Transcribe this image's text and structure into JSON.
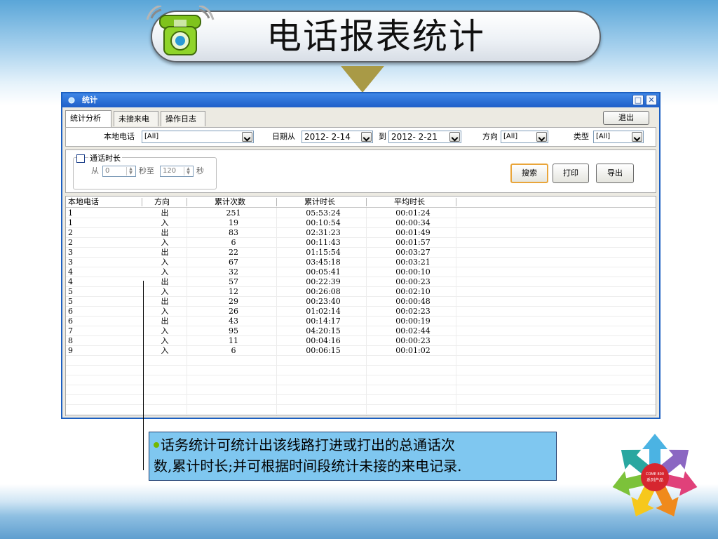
{
  "slide": {
    "title": "电话报表统计",
    "note_lines": [
      "话务统计可统计出该线路打进或打出的总通话次",
      "数,累计时长;并可根据时间段统计未接的来电记录."
    ],
    "logo_text_1": "COME 800",
    "logo_text_2": "系列产品"
  },
  "window": {
    "title": "统计",
    "tabs": [
      "统计分析",
      "未接来电",
      "操作日志"
    ],
    "exit_label": "退出",
    "filters": {
      "local_phone_label": "本地电话",
      "local_phone_value": "[All]",
      "date_from_label": "日期从",
      "date_from_value": "2012-  2-14",
      "date_to_label": "到",
      "date_to_value": "2012-  2-21",
      "direction_label": "方向",
      "direction_value": "[All]",
      "type_label": "类型",
      "type_value": "[All]"
    },
    "duration": {
      "group_label": "通话时长",
      "from_label": "从",
      "from_value": "0",
      "mid_label": "秒至",
      "to_value": "120",
      "unit_label": "秒"
    },
    "buttons": {
      "search": "搜索",
      "print": "打印",
      "export": "导出"
    },
    "table": {
      "headers": [
        "本地电话",
        "方向",
        "累计次数",
        "累计时长",
        "平均时长"
      ],
      "rows": [
        [
          "1",
          "出",
          "251",
          "05:53:24",
          "00:01:24"
        ],
        [
          "1",
          "入",
          "19",
          "00:10:54",
          "00:00:34"
        ],
        [
          "2",
          "出",
          "83",
          "02:31:23",
          "00:01:49"
        ],
        [
          "2",
          "入",
          "6",
          "00:11:43",
          "00:01:57"
        ],
        [
          "3",
          "出",
          "22",
          "01:15:54",
          "00:03:27"
        ],
        [
          "3",
          "入",
          "67",
          "03:45:18",
          "00:03:21"
        ],
        [
          "4",
          "入",
          "32",
          "00:05:41",
          "00:00:10"
        ],
        [
          "4",
          "出",
          "57",
          "00:22:39",
          "00:00:23"
        ],
        [
          "5",
          "入",
          "12",
          "00:26:08",
          "00:02:10"
        ],
        [
          "5",
          "出",
          "29",
          "00:23:40",
          "00:00:48"
        ],
        [
          "6",
          "入",
          "26",
          "01:02:14",
          "00:02:23"
        ],
        [
          "6",
          "出",
          "43",
          "00:14:17",
          "00:00:19"
        ],
        [
          "7",
          "入",
          "95",
          "04:20:15",
          "00:02:44"
        ],
        [
          "8",
          "入",
          "11",
          "00:04:16",
          "00:00:23"
        ],
        [
          "9",
          "入",
          "6",
          "00:06:15",
          "00:01:02"
        ]
      ]
    }
  },
  "colors": {
    "titlebar": "#1f5fc9",
    "note_bg": "#7fc7f0",
    "bullet": "#74b800",
    "arrow": "#a99a46"
  }
}
